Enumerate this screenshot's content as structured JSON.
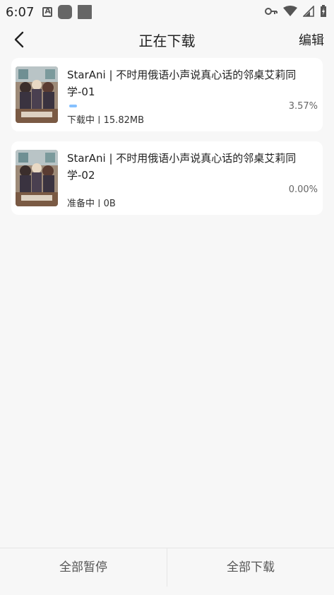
{
  "status_bar": {
    "time": "6:07",
    "left_icons": [
      "keyboard-a-icon",
      "notification-rounded-icon",
      "notification-square-icon"
    ],
    "right_icons": [
      "vpn-key-icon",
      "wifi-icon",
      "signal-icon",
      "battery-charging-icon"
    ]
  },
  "app_bar": {
    "title": "正在下载",
    "edit_label": "编辑"
  },
  "downloads": [
    {
      "title": "StarAni | 不时用俄语小声说真心话的邻桌艾莉同学-01",
      "percent": "3.57%",
      "progress": 0.0357,
      "status": "下载中 | 15.82MB"
    },
    {
      "title": "StarAni | 不时用俄语小声说真心话的邻桌艾莉同学-02",
      "percent": "0.00%",
      "progress": 0,
      "status": "准备中 | 0B"
    }
  ],
  "bottom_bar": {
    "pause_all_label": "全部暂停",
    "download_all_label": "全部下载"
  },
  "colors": {
    "background": "#f7f7f7",
    "card": "#ffffff",
    "progress": "#86c1ff",
    "text": "#222222"
  }
}
